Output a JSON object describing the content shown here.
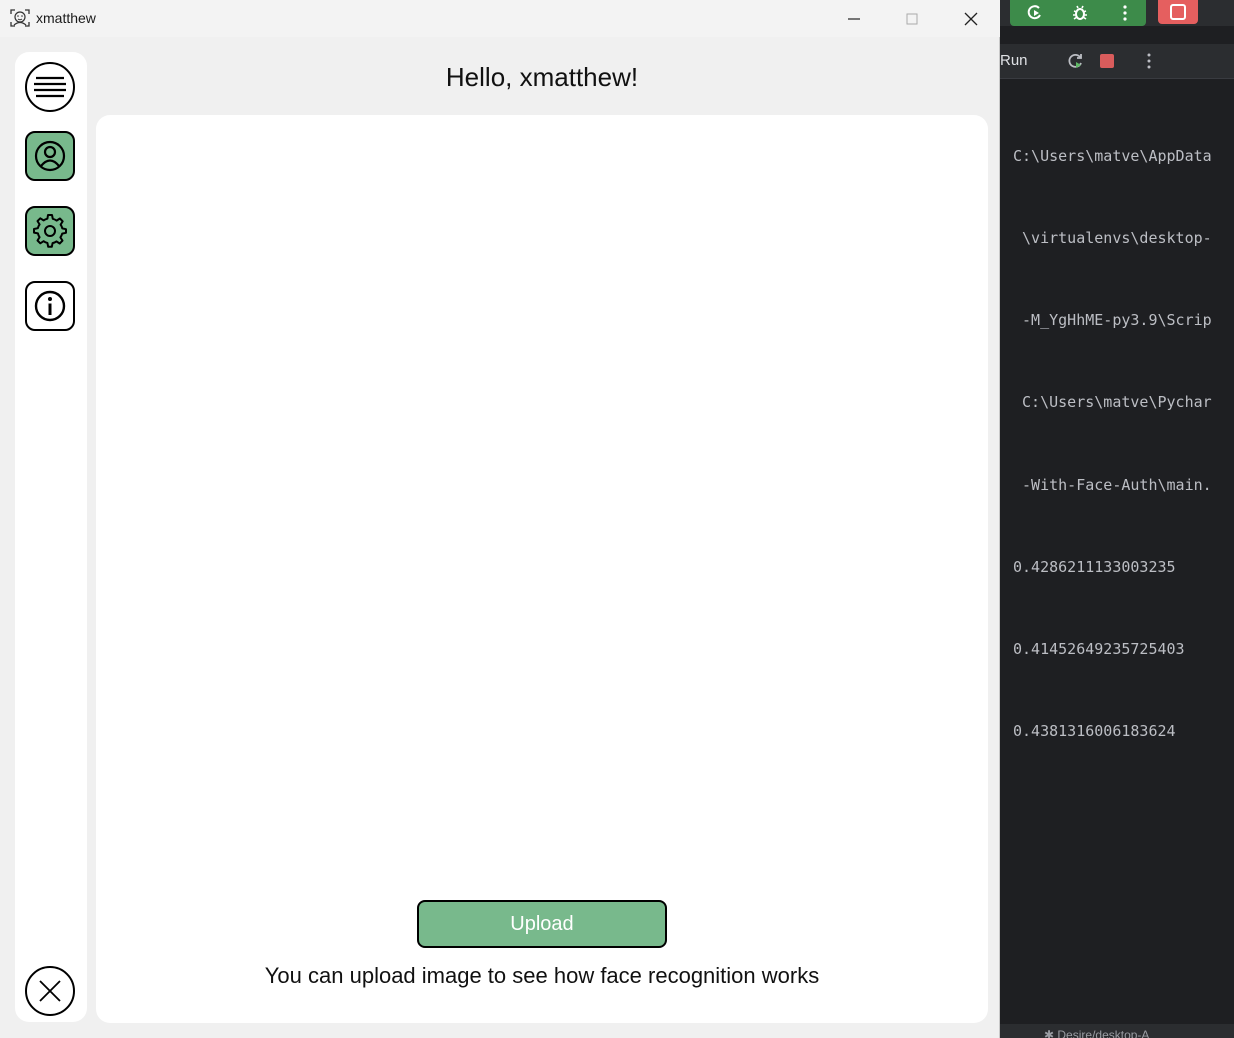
{
  "window": {
    "title": "xmatthew"
  },
  "app": {
    "greeting": "Hello, xmatthew!",
    "upload_label": "Upload",
    "hint": "You can upload image to see how face recognition works",
    "accent_color": "#78b98c"
  },
  "sidebar": {
    "items": [
      {
        "name": "menu",
        "icon": "hamburger-icon"
      },
      {
        "name": "profile",
        "icon": "user-icon",
        "active": true
      },
      {
        "name": "settings",
        "icon": "gear-icon"
      },
      {
        "name": "info",
        "icon": "info-icon"
      },
      {
        "name": "close",
        "icon": "close-icon"
      }
    ]
  },
  "ide": {
    "run_label": "Run",
    "console_lines": [
      "C:\\Users\\matve\\AppData",
      " \\virtualenvs\\desktop-",
      " -M_YgHhME-py3.9\\Scrip",
      " C:\\Users\\matve\\Pychar",
      " -With-Face-Auth\\main.",
      "0.4286211133003235",
      "0.41452649235725403",
      "0.4381316006183624"
    ],
    "status_text": "✱ Desire/desktop-A"
  }
}
